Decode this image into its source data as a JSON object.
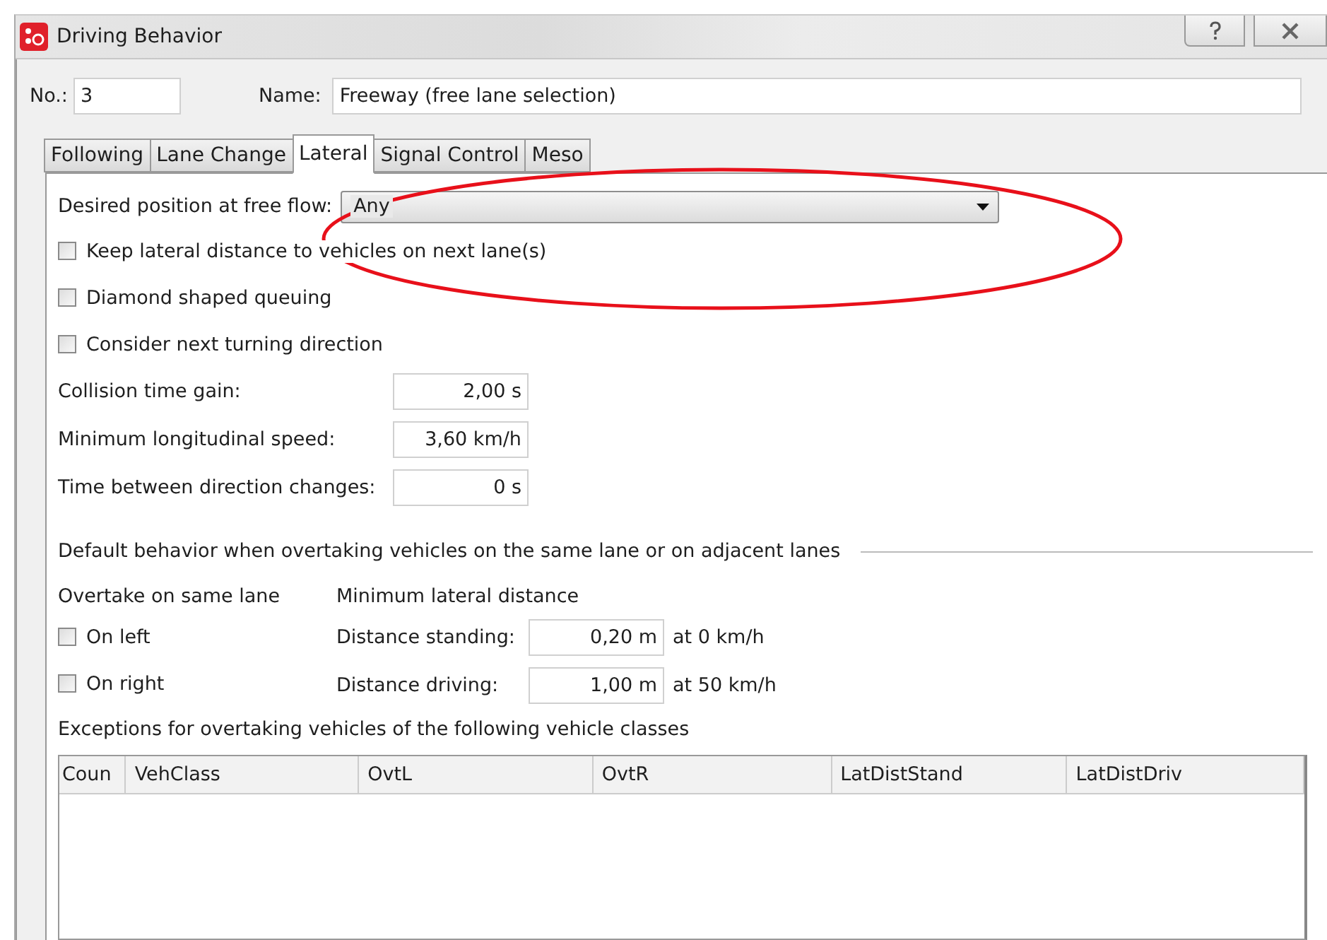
{
  "window": {
    "title": "Driving Behavior"
  },
  "number": {
    "label": "No.:",
    "value": "3"
  },
  "name": {
    "label": "Name:",
    "value": "Freeway (free lane selection)"
  },
  "tabs": [
    {
      "label": "Following",
      "selected": false
    },
    {
      "label": "Lane Change",
      "selected": false
    },
    {
      "label": "Lateral",
      "selected": true
    },
    {
      "label": "Signal Control",
      "selected": false
    },
    {
      "label": "Meso",
      "selected": false
    }
  ],
  "desired_position": {
    "label": "Desired position at free flow:",
    "value": "Any"
  },
  "checkboxes": [
    {
      "label": "Keep lateral distance to vehicles on next lane(s)",
      "checked": false
    },
    {
      "label": "Diamond shaped queuing",
      "checked": false
    },
    {
      "label": "Consider next turning direction",
      "checked": false
    }
  ],
  "fields": [
    {
      "label": "Collision time gain:",
      "value": "2,00 s"
    },
    {
      "label": "Minimum longitudinal speed:",
      "value": "3,60 km/h"
    },
    {
      "label": "Time between direction changes:",
      "value": "0 s"
    }
  ],
  "overtaking": {
    "heading": "Default behavior when overtaking vehicles on the same lane or on adjacent lanes",
    "same_lane": {
      "heading": "Overtake on same lane",
      "options": [
        {
          "label": "On left",
          "checked": false
        },
        {
          "label": "On right",
          "checked": false
        }
      ]
    },
    "lateral_distance": {
      "heading": "Minimum lateral distance",
      "rows": [
        {
          "label": "Distance standing:",
          "value": "0,20 m",
          "note": "at 0 km/h"
        },
        {
          "label": "Distance driving:",
          "value": "1,00 m",
          "note": "at 50 km/h"
        }
      ]
    }
  },
  "exceptions": {
    "heading": "Exceptions for overtaking vehicles of the following vehicle classes",
    "columns": [
      "Coun",
      "VehClass",
      "OvtL",
      "OvtR",
      "LatDistStand",
      "LatDistDriv"
    ]
  }
}
